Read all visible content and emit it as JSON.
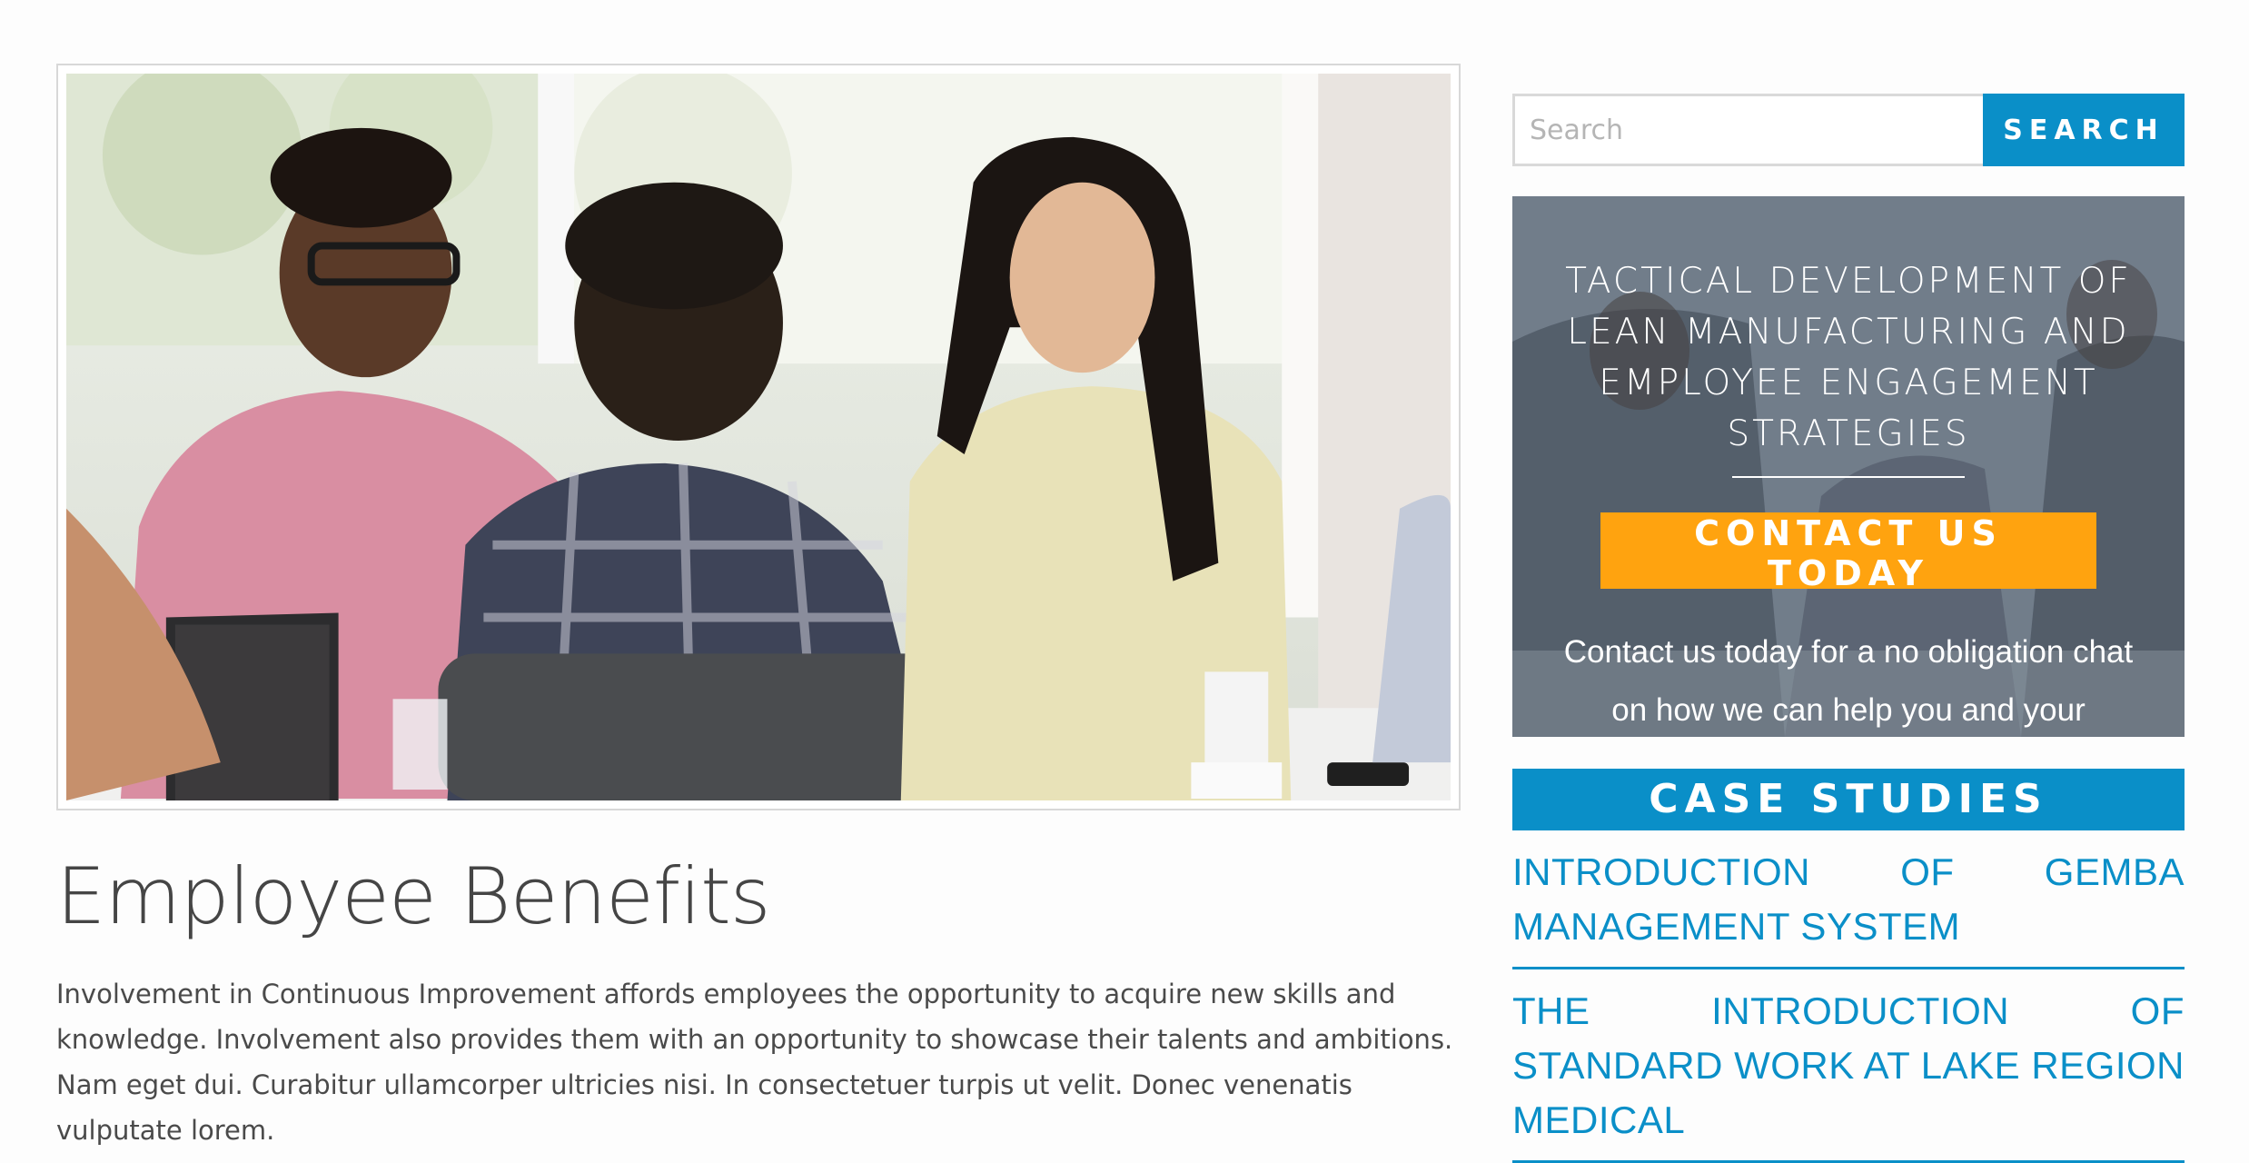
{
  "hero": {
    "image_alt": "Group of coworkers in a meeting around a table"
  },
  "main": {
    "title": "Employee Benefits",
    "intro": "Involvement in Continuous Improvement affords employees the opportunity to acquire new skills and knowledge. Involvement also provides them with an opportunity to showcase their talents and ambitions. Nam eget dui. Curabitur ullamcorper ultricies nisi. In consectetuer turpis ut velit. Donec venenatis vulputate lorem."
  },
  "sidebar": {
    "search": {
      "placeholder": "Search",
      "button_label": "SEARCH"
    },
    "promo": {
      "heading": "TACTICAL DEVELOPMENT OF LEAN MANUFACTURING AND EMPLOYEE ENGAGEMENT STRATEGIES",
      "cta_label": "CONTACT US TODAY",
      "text": "Contact us today for a no obligation chat on how we can help you and your business needs"
    },
    "case_studies": {
      "heading": "CASE STUDIES",
      "items": [
        {
          "label": "INTRODUCTION OF GEMBA MANAGEMENT SYSTEM"
        },
        {
          "label": "THE INTRODUCTION OF STANDARD WORK AT LAKE REGION MEDICAL"
        }
      ]
    }
  },
  "colors": {
    "accent_blue": "#0a8fc8",
    "cta_orange": "#ffa30f",
    "text_dark": "#454545"
  }
}
